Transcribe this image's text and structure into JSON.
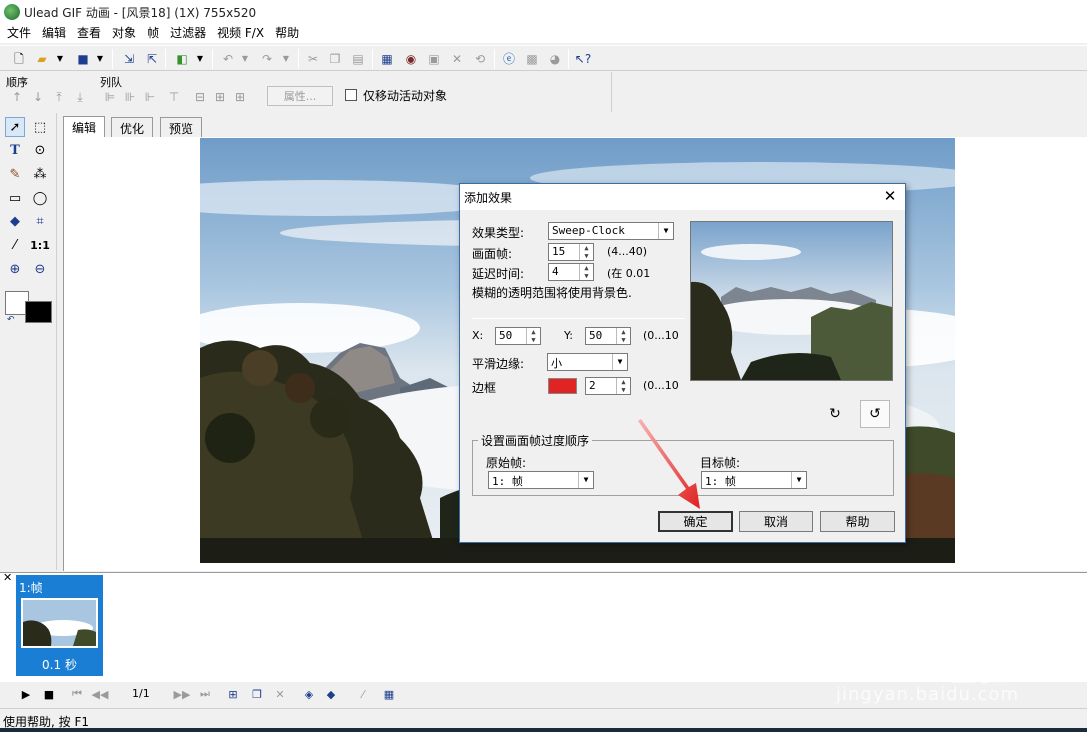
{
  "window": {
    "title": "Ulead GIF 动画 - [风景18] (1X) 755x520"
  },
  "menu": [
    "文件",
    "编辑",
    "查看",
    "对象",
    "帧",
    "过滤器",
    "视频 F/X",
    "帮助"
  ],
  "toolbar2": {
    "order_label": "顺序",
    "align_label": "列队",
    "properties_button": "属性...",
    "move_active_only_label": "仅移动活动对象"
  },
  "tabs": [
    "编辑",
    "优化",
    "预览"
  ],
  "dialog": {
    "title": "添加效果",
    "effect_type_label": "效果类型:",
    "effect_type_value": "Sweep-Clock",
    "frames_label": "画面帧:",
    "frames_value": "15",
    "frames_range": "(4...40)",
    "delay_label": "延迟时间:",
    "delay_value": "4",
    "delay_range": "(在 0.01",
    "blur_note": "模糊的透明范围将使用背景色.",
    "x_label": "X:",
    "x_value": "50",
    "x_range": "(0...10",
    "y_label": "Y:",
    "y_value": "50",
    "smooth_edge_label": "平滑边缘:",
    "smooth_edge_value": "小",
    "border_label": "边框",
    "border_color": "#e02323",
    "border_value": "2",
    "border_range": "(0...10",
    "transition_group_label": "设置画面帧过度顺序",
    "source_frame_label": "原始帧:",
    "source_frame_value": "1: 帧",
    "target_frame_label": "目标帧:",
    "target_frame_value": "1: 帧",
    "ok_button": "确定",
    "cancel_button": "取消",
    "help_button": "帮助"
  },
  "frames_panel": {
    "frame_label": "1:帧",
    "frame_duration": "0.1 秒",
    "frame_counter": "1/1"
  },
  "status": {
    "text": "使用帮助, 按 F1"
  },
  "watermark": {
    "brand": "Baidu经验",
    "url": "jingyan.baidu.com"
  },
  "colors": {
    "accent": "#1a7fd4",
    "arrow": "#e02020"
  }
}
